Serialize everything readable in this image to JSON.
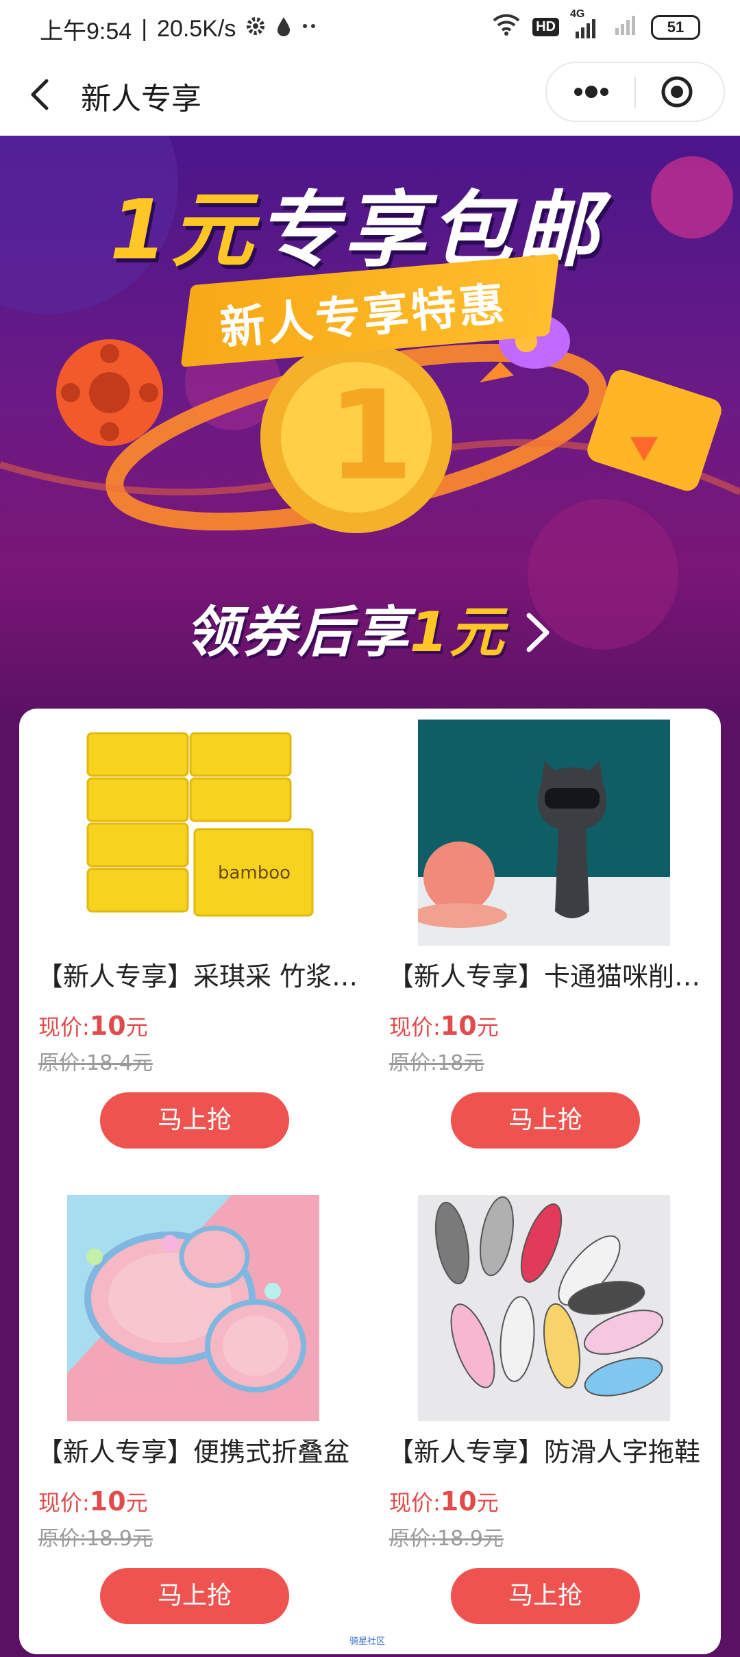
{
  "status_bar": {
    "time": "上午9:54",
    "network_speed": "20.5K/s",
    "hd_label": "HD",
    "signal_label": "4G",
    "battery": "51"
  },
  "nav": {
    "title": "新人专享"
  },
  "banner": {
    "title_number": "1元",
    "title_text": "专享包邮",
    "ribbon_text": "新人专享特惠",
    "cta_prefix": "领券后享",
    "cta_highlight": "1元"
  },
  "products": [
    {
      "name": "【新人专享】采琪采 竹浆本色抽纸",
      "price_label": "现价:",
      "price_value": "10",
      "price_unit": "元",
      "original_price": "原价:18.4元",
      "button_label": "马上抢"
    },
    {
      "name": "【新人专享】卡通猫咪削皮器",
      "price_label": "现价:",
      "price_value": "10",
      "price_unit": "元",
      "original_price": "原价:18元",
      "button_label": "马上抢"
    },
    {
      "name": "【新人专享】便携式折叠盆",
      "price_label": "现价:",
      "price_value": "10",
      "price_unit": "元",
      "original_price": "原价:18.9元",
      "button_label": "马上抢"
    },
    {
      "name": "【新人专享】防滑人字拖鞋",
      "price_label": "现价:",
      "price_value": "10",
      "price_unit": "元",
      "original_price": "原价:18.9元",
      "button_label": "马上抢"
    }
  ],
  "footer_note": "骑星社区",
  "colors": {
    "accent_red": "#ef5350",
    "price_red": "#e14b4b",
    "banner_purple": "#5a1063",
    "gold": "#ffc726"
  }
}
